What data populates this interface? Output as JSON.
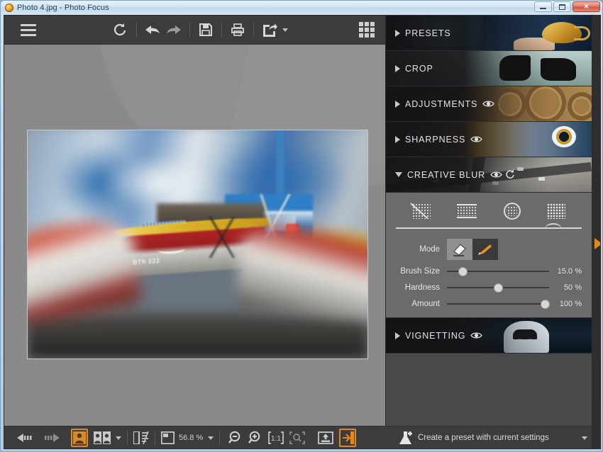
{
  "window": {
    "title": "Photo 4.jpg - Photo Focus",
    "app_icon": "photo-focus-logo-icon",
    "minimize_label": "",
    "maximize_label": "",
    "close_label": "✕"
  },
  "toolbar": {
    "menu_label": "menu",
    "buttons": [
      {
        "name": "reset-button",
        "icon": "reset-arrow-icon"
      },
      {
        "name": "undo-button",
        "icon": "undo-arrow-icon"
      },
      {
        "name": "redo-button",
        "icon": "redo-arrow-icon"
      },
      {
        "name": "save-button",
        "icon": "floppy-disk-icon"
      },
      {
        "name": "print-button",
        "icon": "printer-icon"
      },
      {
        "name": "share-button",
        "icon": "share-arrow-icon"
      }
    ],
    "grid_view_label": "grid-view"
  },
  "canvas": {
    "photo_caption": "Blurred harbour scene with fishing boats",
    "hull_number": "BTh 222"
  },
  "panels": [
    {
      "id": "presets",
      "label": "PRESETS",
      "expanded": false,
      "has_eye": false,
      "has_reset": false
    },
    {
      "id": "crop",
      "label": "CROP",
      "expanded": false,
      "has_eye": false,
      "has_reset": false
    },
    {
      "id": "adjustments",
      "label": "ADJUSTMENTS",
      "expanded": false,
      "has_eye": true,
      "has_reset": false
    },
    {
      "id": "sharpness",
      "label": "SHARPNESS",
      "expanded": false,
      "has_eye": true,
      "has_reset": false
    },
    {
      "id": "creative-blur",
      "label": "CREATIVE BLUR",
      "expanded": true,
      "has_eye": true,
      "has_reset": true
    },
    {
      "id": "vignetting",
      "label": "VIGNETTING",
      "expanded": false,
      "has_eye": true,
      "has_reset": false
    }
  ],
  "creative_blur": {
    "blur_types": [
      {
        "name": "blur-type-none",
        "icon": "dots-crossed-icon",
        "selected": false
      },
      {
        "name": "blur-type-linear",
        "icon": "dots-linear-icon",
        "selected": false
      },
      {
        "name": "blur-type-radial",
        "icon": "dots-radial-icon",
        "selected": false
      },
      {
        "name": "blur-type-freehand",
        "icon": "dots-freehand-icon",
        "selected": true
      }
    ],
    "mode": {
      "label": "Mode",
      "options": [
        {
          "name": "mode-eraser",
          "icon": "eraser-icon",
          "selected": true
        },
        {
          "name": "mode-brush",
          "icon": "brush-icon",
          "selected": false
        }
      ]
    },
    "sliders": [
      {
        "name": "brush-size-slider",
        "label": "Brush Size",
        "value": "15.0 %",
        "percent": 15
      },
      {
        "name": "hardness-slider",
        "label": "Hardness",
        "value": "50 %",
        "percent": 50
      },
      {
        "name": "amount-slider",
        "label": "Amount",
        "value": "100 %",
        "percent": 100
      }
    ]
  },
  "statusbar": {
    "prev_label": "previous-photo",
    "next_label": "next-photo",
    "single_view_label": "single-view",
    "compare_view_label": "compare-view",
    "split_view_label": "split-view",
    "zoom_value": "56.8 %",
    "zoom_out_label": "zoom-out",
    "zoom_in_label": "zoom-in",
    "actual_size_label": "1:1",
    "fit_label": "fit-to-window",
    "export_label": "export",
    "open_in_editor_label": "open-in-editor"
  },
  "preset_bar": {
    "text": "Create a preset with current settings",
    "icon": "flask-plus-icon"
  },
  "colors": {
    "accent": "#e08a1e",
    "panel_bg": "#4a4a4a",
    "toolbar_bg": "#3c3c3c",
    "canvas_bg": "#8a8a8a",
    "controls_bg": "#6b6b6b",
    "text": "#e4e4e4"
  }
}
